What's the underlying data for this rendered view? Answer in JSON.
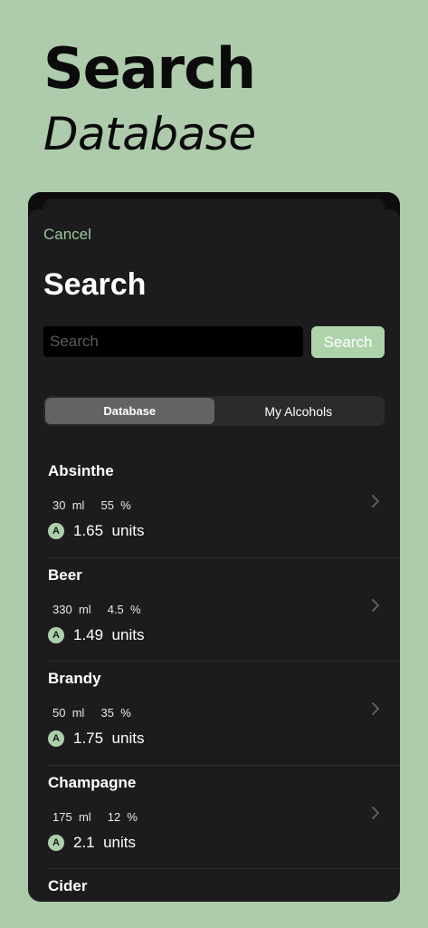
{
  "hero": {
    "title": "Search",
    "subtitle": "Database"
  },
  "sheet": {
    "cancel_label": "Cancel",
    "title": "Search",
    "search": {
      "placeholder": "Search",
      "value": "",
      "button_label": "Search"
    },
    "segments": [
      {
        "label": "Database",
        "selected": true
      },
      {
        "label": "My Alcohols",
        "selected": false
      }
    ],
    "items": [
      {
        "name": "Absinthe",
        "volume": "30",
        "volume_unit": "ml",
        "abv": "55",
        "abv_unit": "%",
        "units": "1.65",
        "units_label": "units",
        "badge": "A"
      },
      {
        "name": "Beer",
        "volume": "330",
        "volume_unit": "ml",
        "abv": "4.5",
        "abv_unit": "%",
        "units": "1.49",
        "units_label": "units",
        "badge": "A"
      },
      {
        "name": "Brandy",
        "volume": "50",
        "volume_unit": "ml",
        "abv": "35",
        "abv_unit": "%",
        "units": "1.75",
        "units_label": "units",
        "badge": "A"
      },
      {
        "name": "Champagne",
        "volume": "175",
        "volume_unit": "ml",
        "abv": "12",
        "abv_unit": "%",
        "units": "2.1",
        "units_label": "units",
        "badge": "A"
      },
      {
        "name": "Cider"
      }
    ]
  },
  "colors": {
    "background": "#aecbac",
    "accent": "#9cc69a",
    "sheet": "#1c1c1e"
  }
}
